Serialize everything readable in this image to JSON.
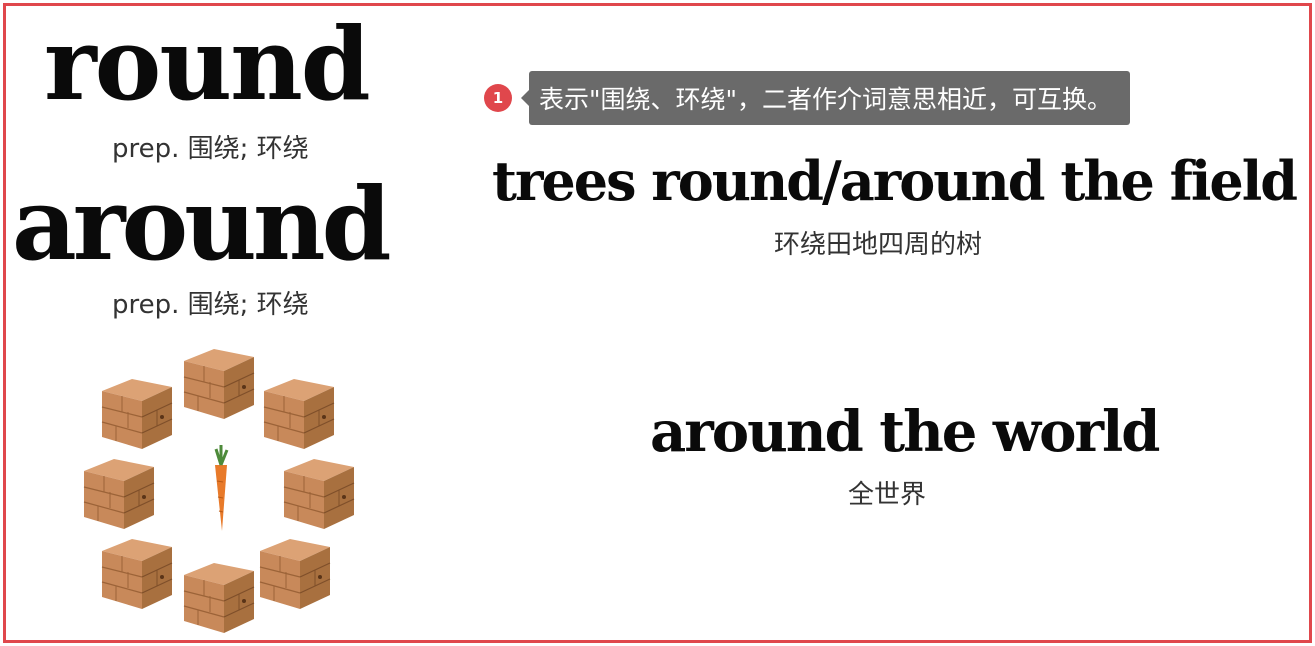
{
  "words": [
    {
      "term": "round",
      "gloss": "prep. 围绕; 环绕"
    },
    {
      "term": "around",
      "gloss": "prep. 围绕; 环绕"
    }
  ],
  "note": {
    "badge": "1",
    "text": "表示\"围绕、环绕\"，二者作介词意思相近，可互换。"
  },
  "examples": [
    {
      "en": "trees round/around the field",
      "zh": "环绕田地四周的树"
    },
    {
      "en": "around the world",
      "zh": "全世界"
    }
  ],
  "illustration": {
    "icon": "blocks-around-carrot",
    "colors": {
      "wood": "#c8895a",
      "wood_dark": "#9c6338",
      "carrot": "#e87a2a",
      "leaf": "#4d8a3a"
    }
  },
  "colors": {
    "border": "#e0474c",
    "tooltip_bg": "#6a6a6a",
    "badge": "#e0474c"
  }
}
